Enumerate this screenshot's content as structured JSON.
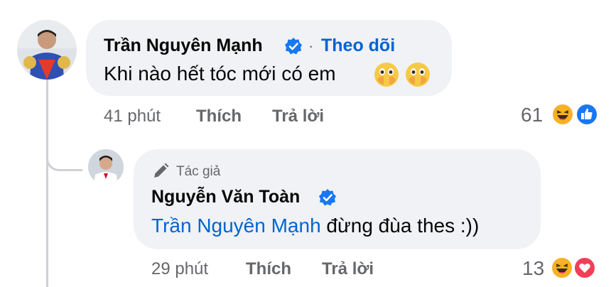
{
  "comment": {
    "author": "Trần Nguyên Mạnh",
    "separator": "·",
    "follow_label": "Theo dõi",
    "text": "Khi nào hết tóc mới có em",
    "emoji": [
      "face-with-open-eyes-and-hand-over-mouth",
      "face-with-open-eyes-and-hand-over-mouth"
    ],
    "time": "41 phút",
    "like_label": "Thích",
    "reply_label": "Trả lời",
    "reaction_count": "61",
    "reactions": [
      "haha",
      "like"
    ]
  },
  "reply": {
    "author_badge": "Tác giả",
    "author": "Nguyễn Văn Toàn",
    "mention": "Trần Nguyên Mạnh",
    "text": " đừng đùa thes :))",
    "time": "29 phút",
    "like_label": "Thích",
    "reply_label": "Trả lời",
    "reaction_count": "13",
    "reactions": [
      "haha",
      "love"
    ]
  },
  "colors": {
    "link": "#0064d1",
    "bubble": "#f0f2f5",
    "meta": "#65676b",
    "verified": "#1877f2",
    "love": "#f33e58",
    "haha": "#f7b125"
  }
}
